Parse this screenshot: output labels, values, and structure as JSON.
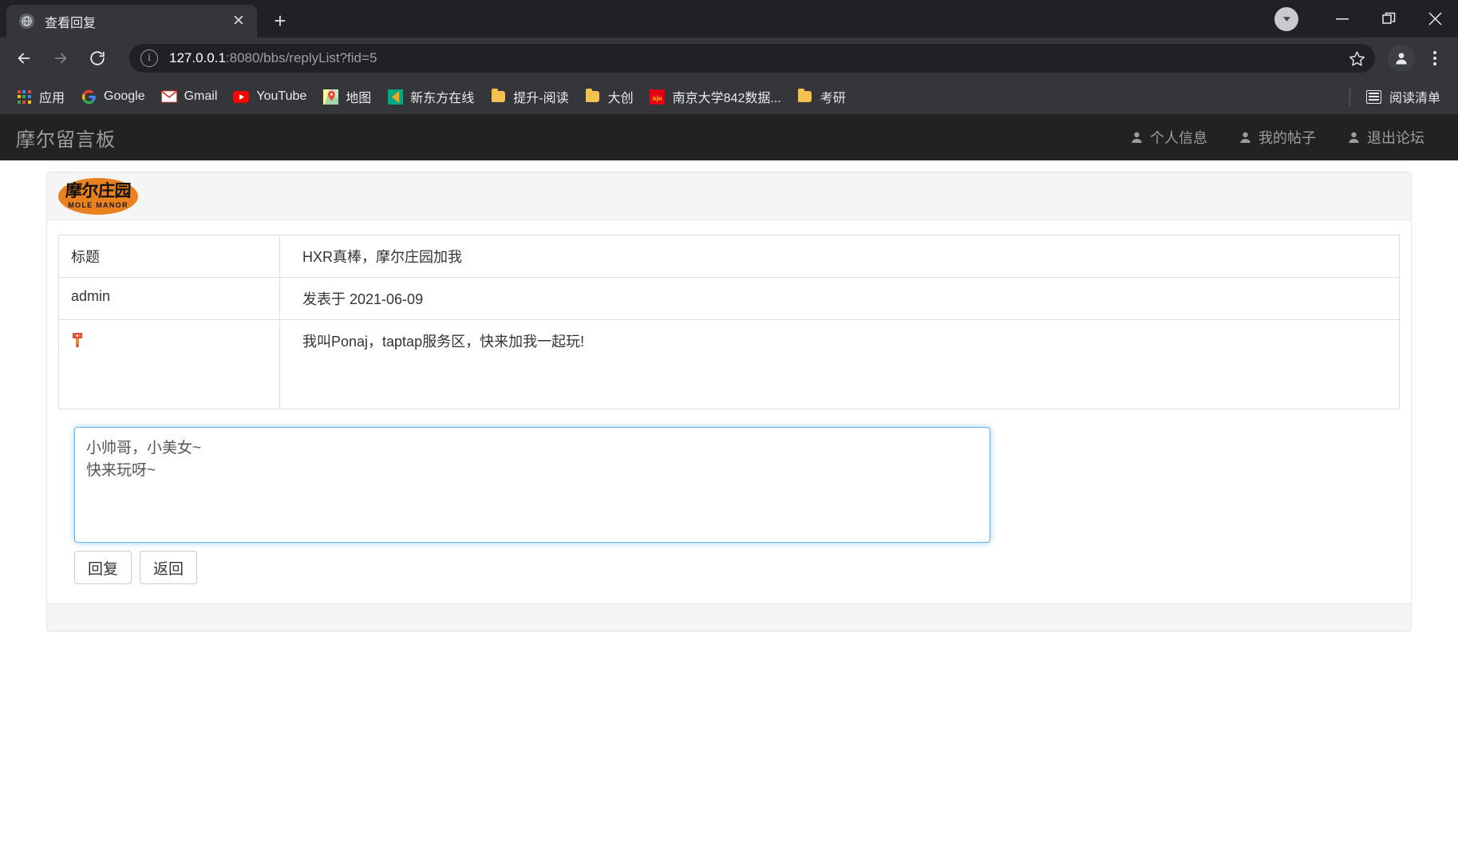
{
  "browser": {
    "tab": {
      "title": "查看回复",
      "favicon_icon": "globe-icon",
      "close_icon": "close-icon"
    },
    "new_tab_label": "+",
    "window_controls": {
      "profile_badge_icon": "caret-down-circle-icon",
      "minimize_label": "—",
      "maximize_icon": "restore-icon",
      "close_label": "✕"
    },
    "toolbar": {
      "back_icon": "arrow-left-icon",
      "forward_icon": "arrow-right-icon",
      "reload_icon": "reload-icon",
      "site_info_icon": "info-circle-icon",
      "url_host": "127.0.0.1",
      "url_rest": ":8080/bbs/replyList?fid=5",
      "bookmark_icon": "star-icon",
      "profile_icon": "person-icon",
      "menu_icon": "kebab-menu-icon"
    },
    "bookmarks": [
      {
        "label": "应用",
        "icon": "apps-grid-icon"
      },
      {
        "label": "Google",
        "icon": "google-icon"
      },
      {
        "label": "Gmail",
        "icon": "gmail-icon"
      },
      {
        "label": "YouTube",
        "icon": "youtube-icon"
      },
      {
        "label": "地图",
        "icon": "maps-pin-icon"
      },
      {
        "label": "新东方在线",
        "icon": "xdf-icon"
      },
      {
        "label": "提升-阅读",
        "icon": "folder-icon"
      },
      {
        "label": "大创",
        "icon": "folder-icon"
      },
      {
        "label": "南京大学842数据...",
        "icon": "nju-icon"
      },
      {
        "label": "考研",
        "icon": "folder-icon"
      }
    ],
    "reading_list": {
      "label": "阅读清单",
      "icon": "reading-list-icon"
    }
  },
  "site": {
    "brand": "摩尔留言板",
    "nav_links": [
      {
        "label": "个人信息",
        "icon": "user-icon"
      },
      {
        "label": "我的帖子",
        "icon": "user-icon"
      },
      {
        "label": "退出论坛",
        "icon": "user-icon"
      }
    ],
    "logo": {
      "cn": "摩尔庄园",
      "en": "MOLE MANOR",
      "color": "#e8811e"
    },
    "post": {
      "rows": [
        {
          "label": "标题",
          "value": "HXR真棒，摩尔庄园加我",
          "type": "text"
        },
        {
          "label": "admin",
          "value": "发表于  2021-06-09",
          "type": "text"
        },
        {
          "label": "",
          "value": "我叫Ponaj，taptap服务区，快来加我一起玩!",
          "type": "avatar",
          "avatar_icon": "broken-image-avatar-icon"
        }
      ]
    },
    "reply": {
      "textarea_value": "小帅哥，小美女~\n快来玩呀~",
      "textarea_placeholder": "",
      "buttons": [
        {
          "label": "回复",
          "name": "reply-button"
        },
        {
          "label": "返回",
          "name": "back-button"
        }
      ]
    }
  }
}
